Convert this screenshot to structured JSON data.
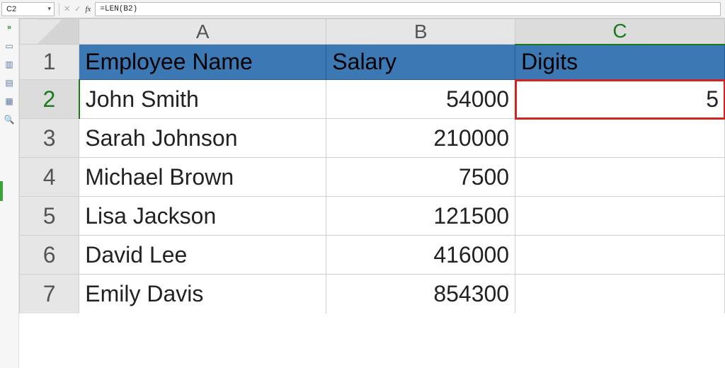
{
  "formula_bar": {
    "name_box": "C2",
    "formula_text": "=LEN(B2)"
  },
  "column_headers": [
    "A",
    "B",
    "C"
  ],
  "row_headers": [
    "1",
    "2",
    "3",
    "4",
    "5",
    "6",
    "7"
  ],
  "table": {
    "header": {
      "A": "Employee Name",
      "B": "Salary",
      "C": "Digits"
    },
    "rows": [
      {
        "A": "John Smith",
        "B": "54000",
        "C": "5"
      },
      {
        "A": "Sarah Johnson",
        "B": "210000",
        "C": ""
      },
      {
        "A": "Michael Brown",
        "B": "7500",
        "C": ""
      },
      {
        "A": "Lisa Jackson",
        "B": "121500",
        "C": ""
      },
      {
        "A": "David Lee",
        "B": "416000",
        "C": ""
      },
      {
        "A": "Emily Davis",
        "B": "854300",
        "C": ""
      }
    ]
  },
  "active_cell": "C2",
  "colors": {
    "header_fill": "#3b78b4",
    "active_outline": "#d22323",
    "sheet_accent": "#1a7a1a"
  },
  "side_icons": [
    "expand",
    "pane1",
    "pane2",
    "pane3",
    "grid",
    "binoculars"
  ]
}
